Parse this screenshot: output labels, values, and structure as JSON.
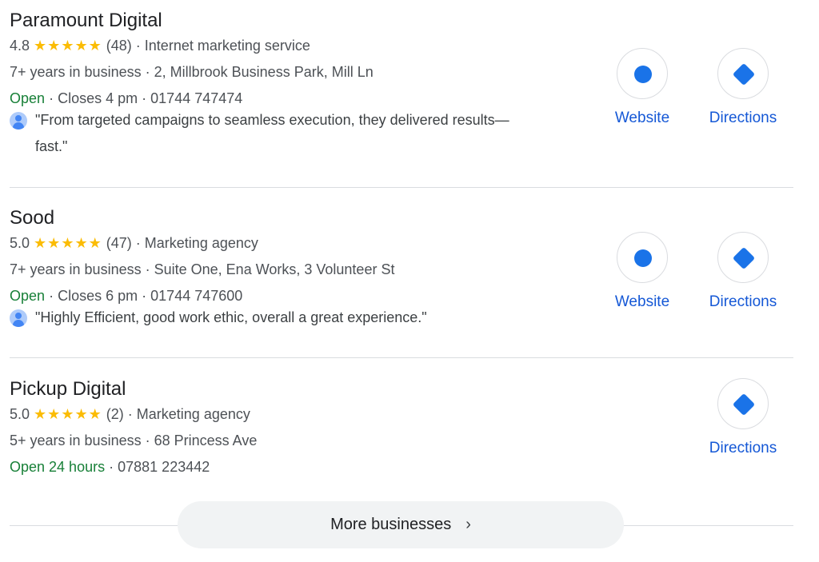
{
  "listings": [
    {
      "name": "Paramount Digital",
      "rating": "4.8",
      "stars": "★★★★★",
      "reviews": "(48)",
      "category": "Internet marketing service",
      "years": "7+ years in business",
      "address": "2, Millbrook Business Park, Mill Ln",
      "open": "Open",
      "closes": "Closes 4 pm",
      "phone": "01744 747474",
      "review_line1": "\"From targeted campaigns to seamless execution, they delivered results—",
      "review_line2": "fast.\"",
      "website_label": "Website",
      "directions_label": "Directions"
    },
    {
      "name": "Sood",
      "rating": "5.0",
      "stars": "★★★★★",
      "reviews": "(47)",
      "category": "Marketing agency",
      "years": "7+ years in business",
      "address": "Suite One, Ena Works, 3 Volunteer St",
      "open": "Open",
      "closes": "Closes 6 pm",
      "phone": "01744 747600",
      "review_line1": "\"Highly Efficient, good work ethic, overall a great experience.\"",
      "website_label": "Website",
      "directions_label": "Directions"
    },
    {
      "name": "Pickup Digital",
      "rating": "5.0",
      "stars": "★★★★★",
      "reviews": "(2)",
      "category": "Marketing agency",
      "years": "5+ years in business",
      "address": "68 Princess Ave",
      "open": "Open 24 hours",
      "phone": "07881 223442",
      "directions_label": "Directions"
    }
  ],
  "separator": "·",
  "more_button": {
    "label": "More businesses",
    "chevron": "›"
  },
  "colors": {
    "star": "#fbbc04",
    "open": "#188038",
    "link": "#1558d6",
    "icon": "#1a73e8"
  }
}
